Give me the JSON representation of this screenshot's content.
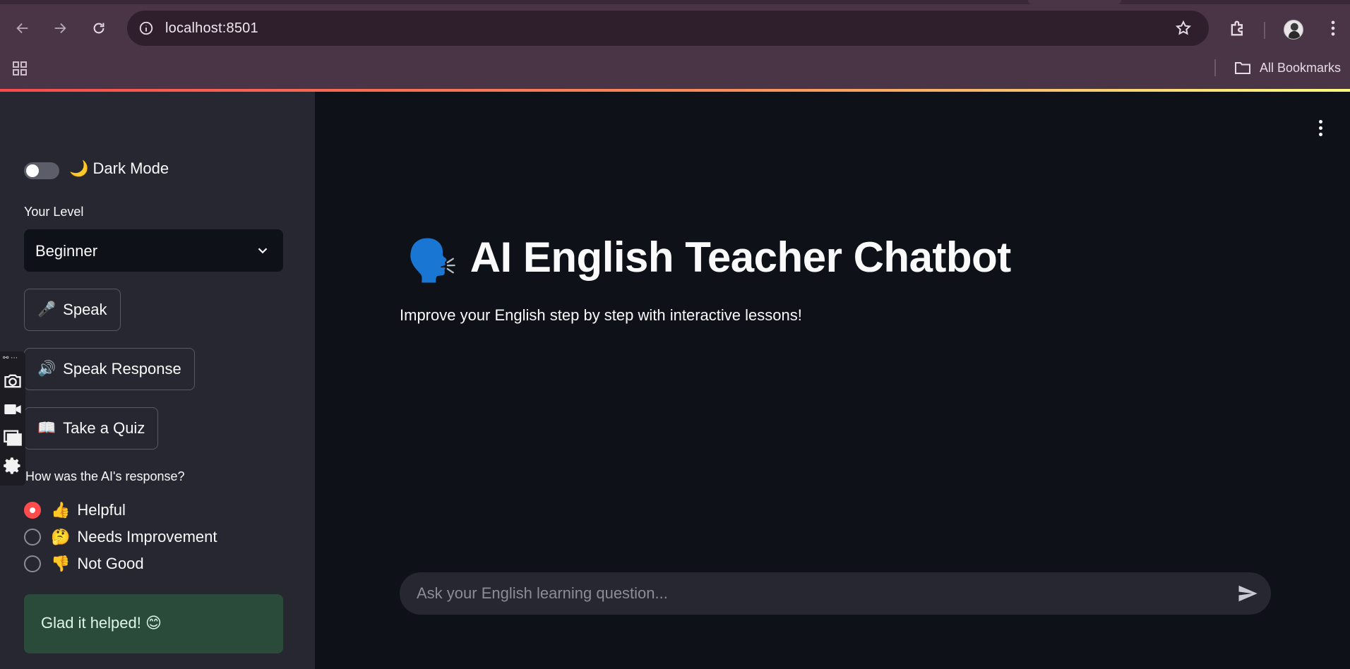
{
  "browser": {
    "url": "localhost:8501",
    "bookmarks_label": "All Bookmarks",
    "icons": [
      "back-icon",
      "forward-icon",
      "reload-icon",
      "site-info-icon",
      "star-icon",
      "extensions-icon",
      "profile-avatar",
      "menu-icon",
      "apps-grid-icon",
      "folder-icon"
    ]
  },
  "sidebar": {
    "dark_mode_label": "🌙 Dark Mode",
    "dark_mode_on": false,
    "level_label": "Your Level",
    "level_value": "Beginner",
    "buttons": [
      {
        "emoji": "🎤",
        "label": "Speak"
      },
      {
        "emoji": "🔊",
        "label": "Speak Response"
      },
      {
        "emoji": "📖",
        "label": "Take a Quiz"
      }
    ],
    "feedback_question": "How was the AI's response?",
    "feedback_options": [
      {
        "emoji": "👍",
        "label": "Helpful",
        "selected": true
      },
      {
        "emoji": "🤔",
        "label": "Needs Improvement",
        "selected": false
      },
      {
        "emoji": "👎",
        "label": "Not Good",
        "selected": false
      }
    ],
    "success_message": "Glad it helped! 😊"
  },
  "main": {
    "title_emoji": "🗣️",
    "title": "AI English Teacher Chatbot",
    "subtitle": "Improve your English step by step with interactive lessons!",
    "chat_placeholder": "Ask your English learning question..."
  },
  "colors": {
    "accent": "#ff4b4b",
    "sidebar_bg": "#262730",
    "main_bg": "#0e1117",
    "success_bg": "#2a4a3a"
  }
}
